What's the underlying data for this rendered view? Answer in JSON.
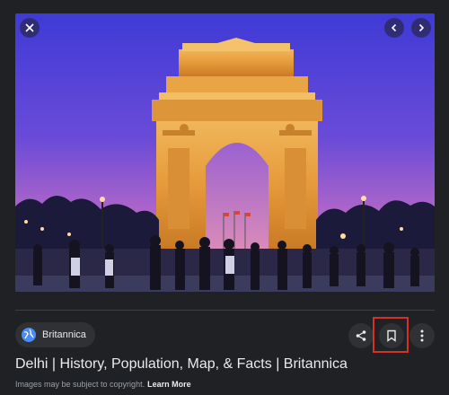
{
  "viewer": {
    "close_icon": "close-icon",
    "prev_icon": "chevron-left-icon",
    "next_icon": "chevron-right-icon",
    "image_subject": "india-gate-photo"
  },
  "source": {
    "name": "Britannica",
    "icon": "globe-icon"
  },
  "actions": {
    "share_icon": "share-icon",
    "save_icon": "bookmark-icon",
    "more_icon": "more-vert-icon",
    "highlight_color": "#d93025"
  },
  "result": {
    "title": "Delhi | History, Population, Map, & Facts | Britannica",
    "copyright_text": "Images may be subject to copyright.",
    "learn_more": "Learn More"
  },
  "colors": {
    "background": "#202124",
    "chip": "#303134",
    "accent_globe": "#4a8cf7"
  }
}
